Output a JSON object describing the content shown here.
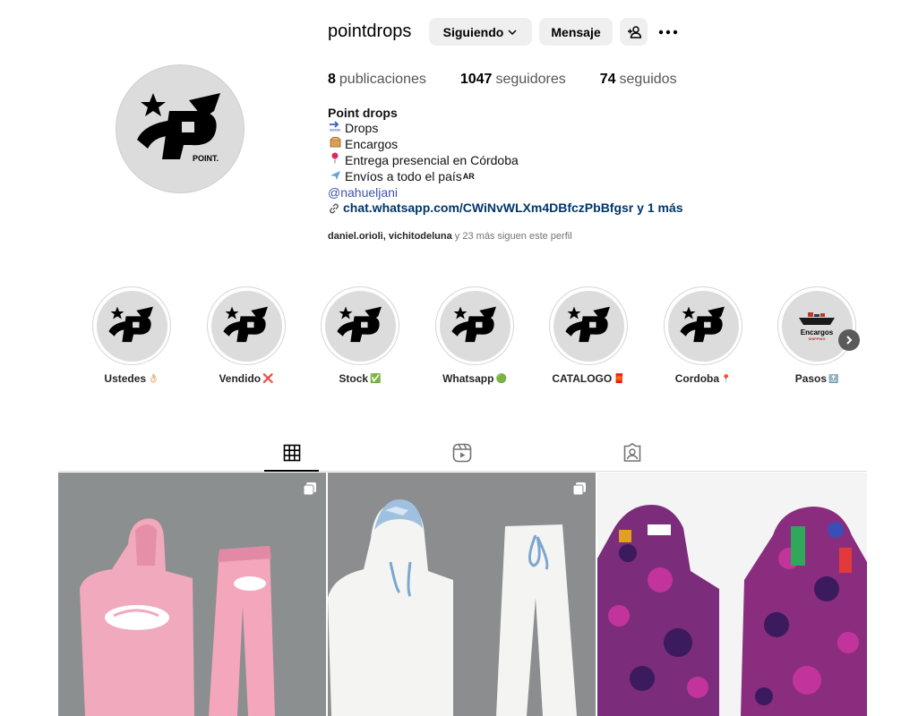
{
  "profile": {
    "username": "pointdrops",
    "follow_button": "Siguiendo",
    "message_button": "Mensaje",
    "stats": {
      "posts_count": "8",
      "posts_label": "publicaciones",
      "followers_count": "1047",
      "followers_label": "seguidores",
      "following_count": "74",
      "following_label": "seguidos"
    },
    "bio": {
      "name": "Point drops",
      "lines": [
        "Drops",
        "Encargos",
        "Entrega presencial en Córdoba",
        "Envíos a todo el país"
      ],
      "line_suffix_4": "AR",
      "mention": "@nahueljani",
      "link": "chat.whatsapp.com/CWiNvWLXm4DBfczPbBfgsr y 1 más"
    },
    "followed_by": {
      "names": "daniel.orioli, vichitodeluna",
      "rest": " y 23 más siguen este perfil"
    }
  },
  "highlights": [
    {
      "label": "Ustedes",
      "emoji": "👌🏻"
    },
    {
      "label": "Vendido",
      "emoji": "❌"
    },
    {
      "label": "Stock",
      "emoji": "✅"
    },
    {
      "label": "Whatsapp",
      "emoji": "🟢"
    },
    {
      "label": "CATALOGO",
      "emoji": "🧧"
    },
    {
      "label": "Cordoba",
      "emoji": "📍"
    },
    {
      "label": "Pasos",
      "emoji": "🔝"
    }
  ],
  "encargos_cover": {
    "title": "Encargos",
    "subtitle": "SHIPPING"
  },
  "logo_text": "POINT.",
  "icons": {
    "follow_chevron": "chevron-down-icon",
    "add_user": "add-user-icon",
    "more": "more-icon",
    "link": "link-icon",
    "tab_posts": "grid-icon",
    "tab_reels": "reels-icon",
    "tab_tagged": "tagged-icon",
    "highlights_next": "chevron-right-icon",
    "multi_post": "carousel-icon"
  },
  "colors": {
    "button_bg": "#efefef",
    "mention": "#4051b5",
    "link": "#00376b",
    "muted": "#737373"
  }
}
